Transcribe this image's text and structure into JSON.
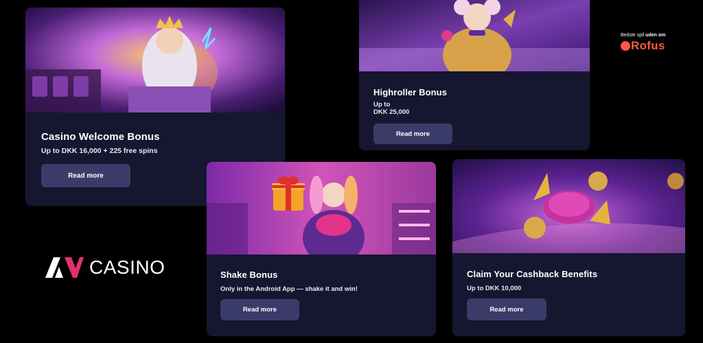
{
  "cards": [
    {
      "title": "Casino Welcome Bonus",
      "subtitle": "Up to DKK 16,000 + 225 free spins",
      "button": "Read more"
    },
    {
      "title": "Highroller Bonus",
      "subtitle_line1": "Up to",
      "subtitle_line2": "DKK 25,000",
      "button": "Read more"
    },
    {
      "title": "Shake Bonus",
      "subtitle": "Only in the Android App — shake it and win!",
      "button": "Read more"
    },
    {
      "title": "Claim Your Cashback Benefits",
      "subtitle": "Up to DKK 10,000",
      "button": "Read more"
    }
  ],
  "brand": {
    "logo_mark": "AV",
    "logo_text": "CASINO"
  },
  "rofus": {
    "tagline_plain": "Bedste spil ",
    "tagline_bold": "uden om",
    "word": "Rofus"
  },
  "colors": {
    "card_bg": "#161630",
    "button_bg": "#3b3b6a",
    "rofus": "#ff5a3c",
    "page_bg": "#000000"
  },
  "icons": [
    "zeus-illustration",
    "joker-girl-illustration",
    "harley-girl-gift-illustration",
    "chip-coins-illustration"
  ]
}
